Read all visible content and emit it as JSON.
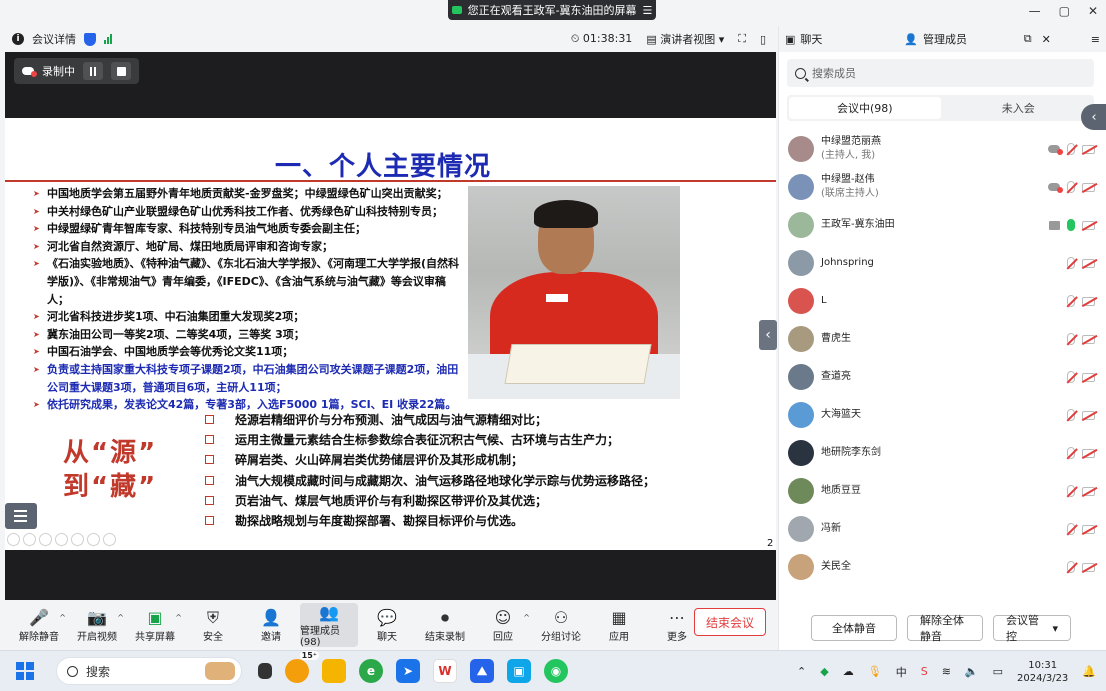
{
  "window": {
    "share_banner": "您正在观看王政军-冀东油田的屏幕",
    "controls": [
      "—",
      "▢",
      "✕"
    ]
  },
  "topbar": {
    "meeting_info": "会议详情",
    "timer": "01:38:31",
    "view_mode": "演讲者视图"
  },
  "recording": {
    "label": "录制中"
  },
  "slide": {
    "title": "一、个人主要情况",
    "bullets": [
      {
        "text": "中国地质学会第五届野外青年地质贡献奖-金罗盘奖；中绿盟绿色矿山突出贡献奖；",
        "color": "black"
      },
      {
        "text": "中关村绿色矿山产业联盟绿色矿山优秀科技工作者、优秀绿色矿山科技特别专员；",
        "color": "black"
      },
      {
        "text": "中绿盟绿矿青年智库专家、科技特别专员油气地质专委会副主任；",
        "color": "black"
      },
      {
        "text": "河北省自然资源厅、地矿局、煤田地质局评审和咨询专家；",
        "color": "black"
      },
      {
        "text": "《石油实验地质》、《特种油气藏》、《东北石油大学学报》、《河南理工大学学报(自然科学版)》、《非常规油气》青年编委，《IFEDC》、《含油气系统与油气藏》等会议审稿人；",
        "color": "black"
      },
      {
        "text": "河北省科技进步奖1项、中石油集团重大发现奖2项；",
        "color": "black"
      },
      {
        "text": "冀东油田公司一等奖2项、二等奖4项，三等奖 3项；",
        "color": "black"
      },
      {
        "text": "中国石油学会、中国地质学会等优秀论文奖11项；",
        "color": "black"
      },
      {
        "text": "负责或主持国家重大科技专项子课题2项，中石油集团公司攻关课题子课题2项，油田公司重大课题3项，普通项目6项，主研人11项；",
        "color": "blue"
      },
      {
        "text": "依托研究成果，发表论文42篇，专著3部，入选F5000 1篇，SCI、EI 收录22篇。",
        "color": "blue"
      }
    ],
    "slogan_line1": "从“源”",
    "slogan_line2": "到“藏”",
    "research_items": [
      "烃源岩精细评价与分布预测、油气成因与油气源精细对比；",
      "运用主微量元素结合生标参数综合表征沉积古气候、古环境与古生产力；",
      "碎屑岩类、火山碎屑岩类优势储层评价及其形成机制；",
      "油气大规模成藏时间与成藏期次、油气运移路径地球化学示踪与优势运移路径；",
      "页岩油气、煤层气地质评价与有利勘探区带评价及其优选；",
      "勘探战略规划与年度勘探部署、勘探目标评价与优选。"
    ],
    "page_number": "2"
  },
  "toolbar": {
    "items": [
      {
        "label": "解除静音",
        "icon": "mic-muted-icon",
        "caret": true
      },
      {
        "label": "开启视频",
        "icon": "camera-off-icon",
        "caret": true
      },
      {
        "label": "共享屏幕",
        "icon": "share-screen-icon",
        "caret": true
      },
      {
        "label": "安全",
        "icon": "shield-icon",
        "caret": false
      },
      {
        "label": "邀请",
        "icon": "invite-icon",
        "caret": false
      },
      {
        "label": "管理成员(98)",
        "icon": "members-icon",
        "caret": false
      },
      {
        "label": "聊天",
        "icon": "chat-icon",
        "caret": false
      },
      {
        "label": "结束录制",
        "icon": "stop-record-icon",
        "caret": false
      },
      {
        "label": "回应",
        "icon": "reaction-icon",
        "caret": true
      },
      {
        "label": "分组讨论",
        "icon": "breakout-icon",
        "caret": false
      },
      {
        "label": "应用",
        "icon": "apps-icon",
        "caret": false
      },
      {
        "label": "更多",
        "icon": "more-icon",
        "caret": false
      }
    ],
    "end_meeting": "结束会议"
  },
  "panel": {
    "chat_tab": "聊天",
    "members_tab": "管理成员",
    "search_placeholder": "搜索成员",
    "in_meeting_tab": "会议中(98)",
    "not_joined_tab": "未入会",
    "members": [
      {
        "name": "中绿盟范丽燕",
        "sub": "(主持人, 我)",
        "avatar": "#a78b8b",
        "rec": true,
        "screen": false,
        "mic_on": false
      },
      {
        "name": "中绿盟-赵伟",
        "sub": "(联席主持人)",
        "avatar": "#7a92b8",
        "rec": true,
        "screen": false,
        "mic_on": false
      },
      {
        "name": "王政军-冀东油田",
        "sub": "",
        "avatar": "#9bb89a",
        "rec": false,
        "screen": true,
        "mic_on": true
      },
      {
        "name": "Johnspring",
        "sub": "",
        "avatar": "#8c9aa8",
        "rec": false,
        "screen": false,
        "mic_on": false
      },
      {
        "name": "L",
        "sub": "",
        "avatar": "#d9534f",
        "rec": false,
        "screen": false,
        "mic_on": false
      },
      {
        "name": "曹虎生",
        "sub": "",
        "avatar": "#a89a7e",
        "rec": false,
        "screen": false,
        "mic_on": false
      },
      {
        "name": "查道亮",
        "sub": "",
        "avatar": "#6a7a8a",
        "rec": false,
        "screen": false,
        "mic_on": false
      },
      {
        "name": "大海篮天",
        "sub": "",
        "avatar": "#5b9bd5",
        "rec": false,
        "screen": false,
        "mic_on": false
      },
      {
        "name": "地研院李东剑",
        "sub": "",
        "avatar": "#2a3340",
        "rec": false,
        "screen": false,
        "mic_on": false
      },
      {
        "name": "地质豆豆",
        "sub": "",
        "avatar": "#6e8a5a",
        "rec": false,
        "screen": false,
        "mic_on": false
      },
      {
        "name": "冯新",
        "sub": "",
        "avatar": "#a0a7ae",
        "rec": false,
        "screen": false,
        "mic_on": false
      },
      {
        "name": "关民全",
        "sub": "",
        "avatar": "#c8a27a",
        "rec": false,
        "screen": false,
        "mic_on": false
      }
    ],
    "mute_all": "全体静音",
    "unmute_all": "解除全体静音",
    "meeting_control": "会议管控"
  },
  "taskbar": {
    "search_placeholder": "搜索",
    "badge": "15⁺",
    "time": "10:31",
    "date": "2024/3/23"
  }
}
